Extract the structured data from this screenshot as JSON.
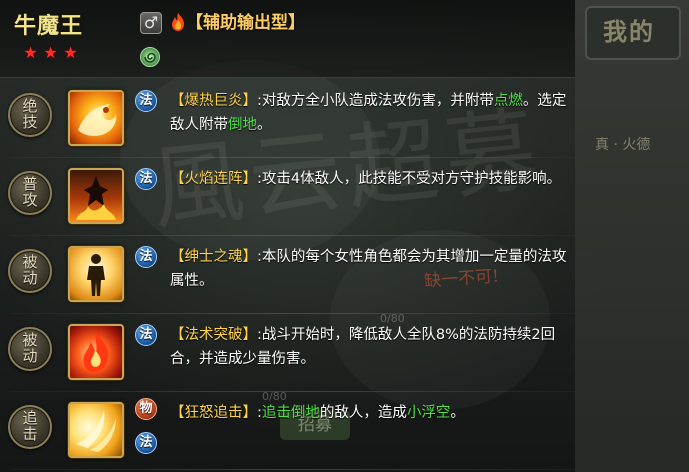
{
  "character": {
    "name": "牛魔王",
    "stars": 3,
    "star_glyph": "★",
    "gender_symbol": "♂",
    "element_icon": "fire-icon",
    "type": "【辅助输出型】",
    "faction_icon": "spiral-emblem-icon"
  },
  "background": {
    "calligraphy": "風云超募",
    "panel_title": "我的",
    "side_text": "真 · 火德",
    "tag_text": "缺一不可!",
    "progress": [
      "0/80",
      "0/80"
    ],
    "recruit_button": "招募"
  },
  "skills": [
    {
      "category": "绝\n技",
      "icon": "dragon-flame-icon",
      "badges": [
        {
          "label": "法",
          "kind": "fa"
        }
      ],
      "name": "【爆热巨炎】",
      "segments": [
        {
          "t": ":对敌方全小队造成法攻伤害，并附带"
        },
        {
          "t": "点燃",
          "hl": true
        },
        {
          "t": "。选定敌人附带"
        },
        {
          "t": "倒地",
          "hl": true
        },
        {
          "t": "。"
        }
      ]
    },
    {
      "category": "普\n攻",
      "icon": "flame-warrior-icon",
      "badges": [
        {
          "label": "法",
          "kind": "fa"
        }
      ],
      "name": "【火焰连阵】",
      "segments": [
        {
          "t": ":攻击4体敌人，此技能不受对方守护技能影响。"
        }
      ]
    },
    {
      "category": "被\n动",
      "icon": "gentleman-silhouette-icon",
      "badges": [
        {
          "label": "法",
          "kind": "fa"
        }
      ],
      "name": "【绅士之魂】",
      "segments": [
        {
          "t": ":本队的每个女性角色都会为其增加一定量的法攻属性。"
        }
      ]
    },
    {
      "category": "被\n动",
      "icon": "fire-burst-icon",
      "badges": [
        {
          "label": "法",
          "kind": "fa"
        }
      ],
      "name": "【法术突破】",
      "segments": [
        {
          "t": ":战斗开始时，降低敌人全队8%的法防持续2回合，并造成少量伤害。"
        }
      ]
    },
    {
      "category": "追\n击",
      "icon": "claw-slash-icon",
      "badges": [
        {
          "label": "物",
          "kind": "wu"
        },
        {
          "label": "法",
          "kind": "fa"
        }
      ],
      "name": "【狂怒追击】",
      "segments": [
        {
          "t": ":"
        },
        {
          "t": "追击倒地",
          "hl": true
        },
        {
          "t": "的敌人，造成"
        },
        {
          "t": "小浮空",
          "hl": true
        },
        {
          "t": "。"
        }
      ]
    }
  ],
  "colors": {
    "name": "#f3e58c",
    "skill_name": "#ffd34a",
    "highlight": "#52e04b",
    "text": "#ffffff",
    "star": "#ff2a2a"
  }
}
